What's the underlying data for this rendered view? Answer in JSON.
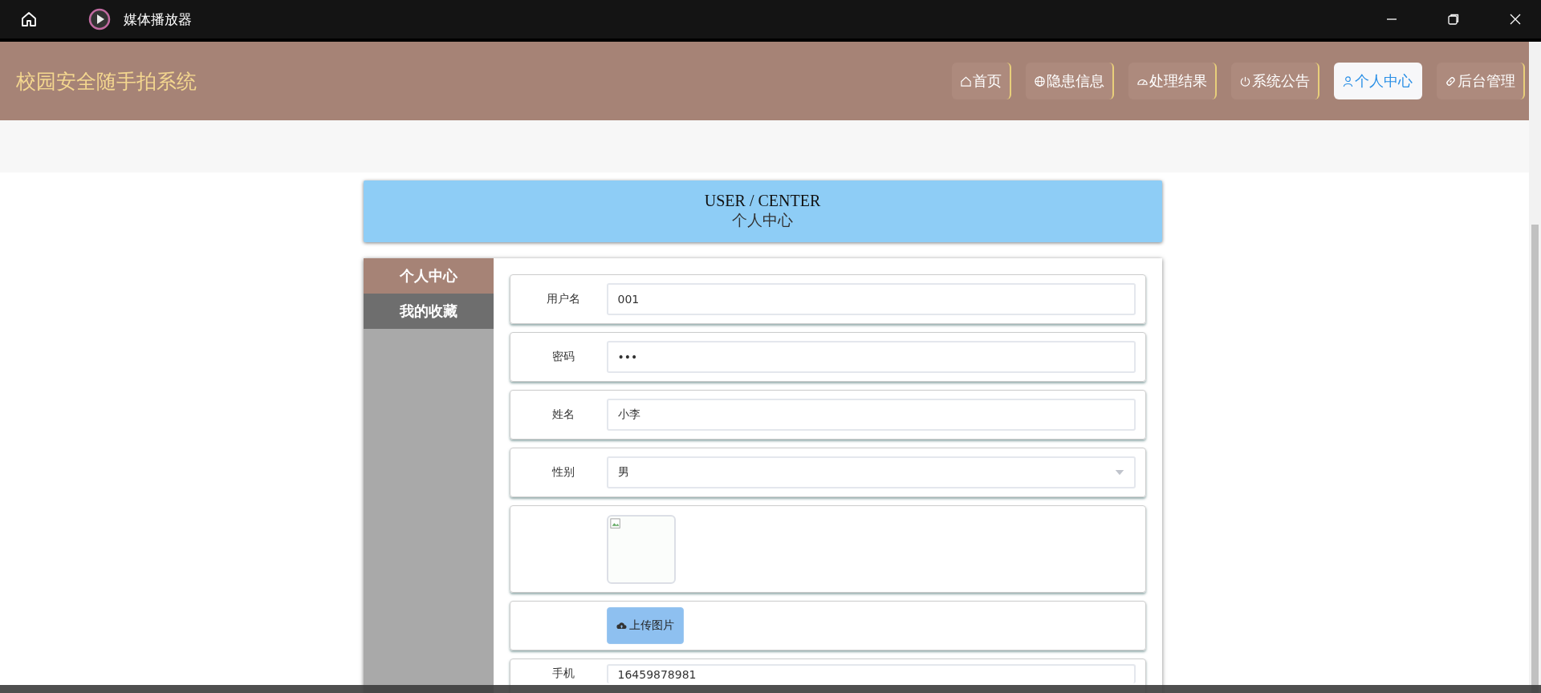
{
  "window": {
    "title": "媒体播放器"
  },
  "site_title": "校园安全随手拍系统",
  "nav": [
    {
      "label": "首页",
      "selected": false
    },
    {
      "label": "隐患信息",
      "selected": false
    },
    {
      "label": "处理结果",
      "selected": false
    },
    {
      "label": "系统公告",
      "selected": false
    },
    {
      "label": "个人中心",
      "selected": true
    },
    {
      "label": "后台管理",
      "selected": false
    }
  ],
  "banner": {
    "title": "USER / CENTER",
    "subtitle": "个人中心"
  },
  "sidebar": {
    "items": [
      {
        "label": "个人中心",
        "selected": true
      },
      {
        "label": "我的收藏",
        "selected": false
      }
    ]
  },
  "form": [
    {
      "kind": "input",
      "label": "用户名",
      "value": "001"
    },
    {
      "kind": "input",
      "label": "密码",
      "value": "•••"
    },
    {
      "kind": "input",
      "label": "姓名",
      "value": "小李"
    },
    {
      "kind": "select",
      "label": "性别",
      "value": "男"
    },
    {
      "kind": "image"
    },
    {
      "kind": "upload",
      "button": "上传图片"
    },
    {
      "kind": "input",
      "label": "手机",
      "value": "16459878981"
    }
  ]
}
